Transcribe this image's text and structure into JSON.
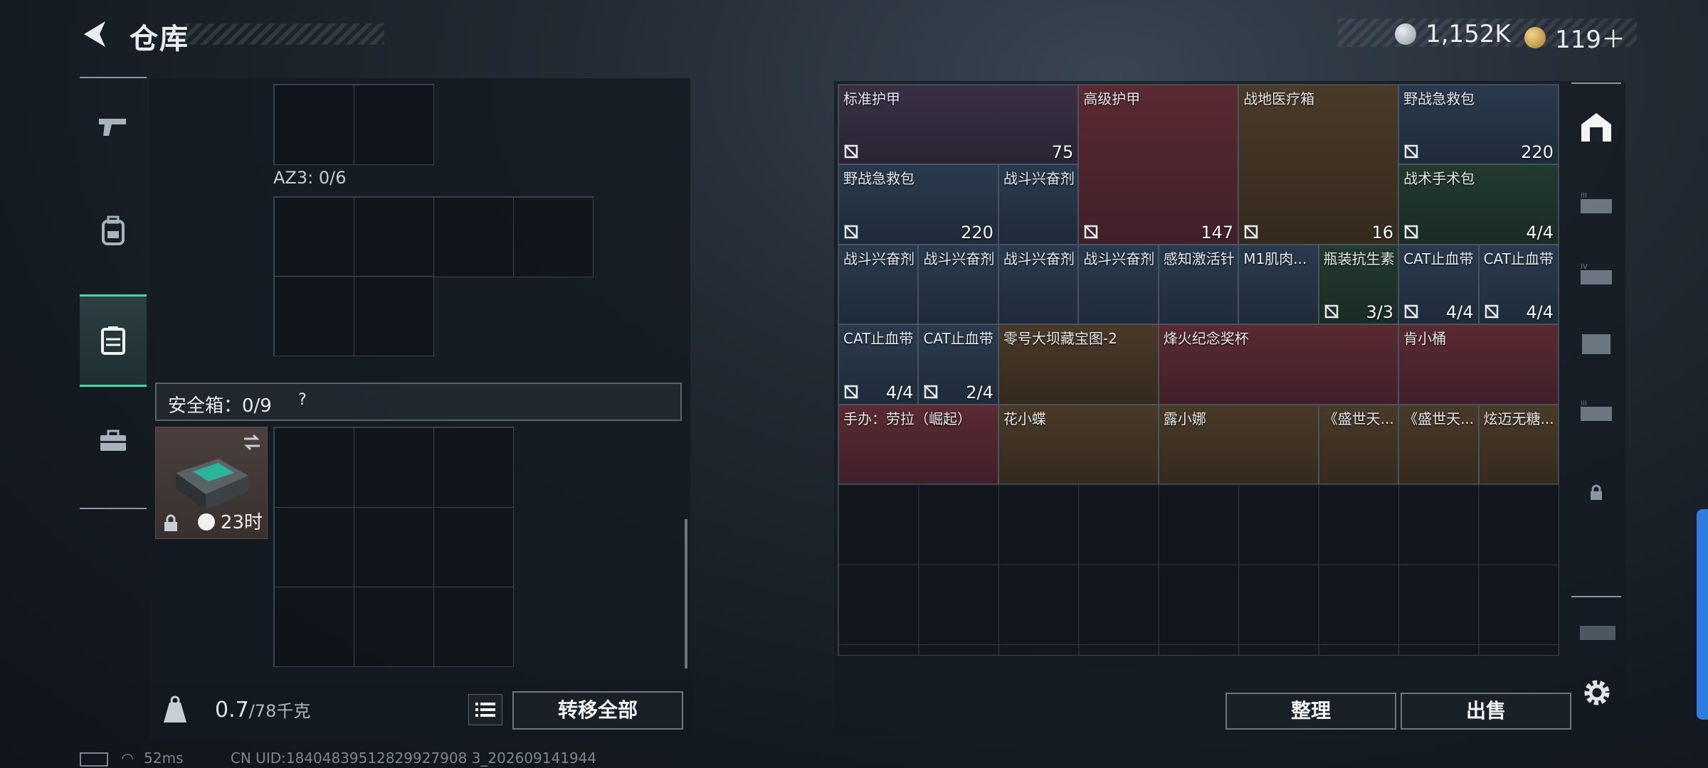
{
  "header": {
    "title": "仓库"
  },
  "currency": {
    "silver": "1,152K",
    "gold": "119＋",
    "silver_color": "#b9c1c9",
    "gold_color": "#c9a24a"
  },
  "left_tabs": [
    "pistol-icon",
    "backpack-icon",
    "vest-icon",
    "toolbox-icon"
  ],
  "left_panel": {
    "az3_label": "AZ3: 0/6",
    "safe_box_label": "安全箱：0/9",
    "safe_help": "?",
    "case_timer": "23时"
  },
  "bottom_bar": {
    "weight_value": "0.7",
    "weight_unit": "/78千克",
    "transfer_all": "转移全部"
  },
  "status": {
    "ping": "52ms",
    "uid": "CN UID:18404839512829927908 3_202609141944"
  },
  "stash": {
    "items": [
      {
        "name": "标准护甲",
        "count": "75",
        "quality": "purple"
      },
      {
        "name": "高级护甲",
        "count": "147",
        "quality": "red"
      },
      {
        "name": "战地医疗箱",
        "count": "16",
        "quality": "gold"
      },
      {
        "name": "野战急救包",
        "count": "220",
        "quality": "blue"
      },
      {
        "name": "野战急救包",
        "count": "220",
        "quality": "blue"
      },
      {
        "name": "战斗兴奋剂",
        "count": "",
        "quality": "blue"
      },
      {
        "name": "战术手术包",
        "count": "4/4",
        "quality": "green"
      },
      {
        "name": "战斗兴奋剂",
        "count": "",
        "quality": "blue"
      },
      {
        "name": "战斗兴奋剂",
        "count": "",
        "quality": "blue"
      },
      {
        "name": "战斗兴奋剂",
        "count": "",
        "quality": "blue"
      },
      {
        "name": "战斗兴奋剂",
        "count": "",
        "quality": "blue"
      },
      {
        "name": "感知激活针",
        "count": "",
        "quality": "blue"
      },
      {
        "name": "M1肌肉...",
        "count": "",
        "quality": "blue"
      },
      {
        "name": "瓶装抗生素",
        "count": "3/3",
        "quality": "green"
      },
      {
        "name": "CAT止血带",
        "count": "4/4",
        "quality": "blue"
      },
      {
        "name": "CAT止血带",
        "count": "4/4",
        "quality": "blue"
      },
      {
        "name": "CAT止血带",
        "count": "4/4",
        "quality": "blue"
      },
      {
        "name": "CAT止血带",
        "count": "2/4",
        "quality": "blue"
      },
      {
        "name": "零号大坝藏宝图-2",
        "count": "",
        "quality": "gold"
      },
      {
        "name": "烽火纪念奖杯",
        "count": "",
        "quality": "red"
      },
      {
        "name": "肯小桶",
        "count": "",
        "quality": "red"
      },
      {
        "name": "手办：劳拉（崛起）",
        "count": "",
        "quality": "red"
      },
      {
        "name": "花小蝶",
        "count": "",
        "quality": "gold"
      },
      {
        "name": "露小娜",
        "count": "",
        "quality": "gold"
      },
      {
        "name": "《盛世天...",
        "count": "",
        "quality": "gold"
      },
      {
        "name": "《盛世天...",
        "count": "",
        "quality": "gold"
      },
      {
        "name": "炫迈无糖...",
        "count": "",
        "quality": "gold"
      }
    ],
    "sort_label": "整理",
    "sell_label": "出售"
  },
  "right_tabs": [
    "house-icon",
    "weapon-case-3-icon",
    "weapon-case-4-icon",
    "folder-case-icon",
    "weapon-case-3b-icon",
    "lock-icon",
    "weapon-case-icon"
  ]
}
